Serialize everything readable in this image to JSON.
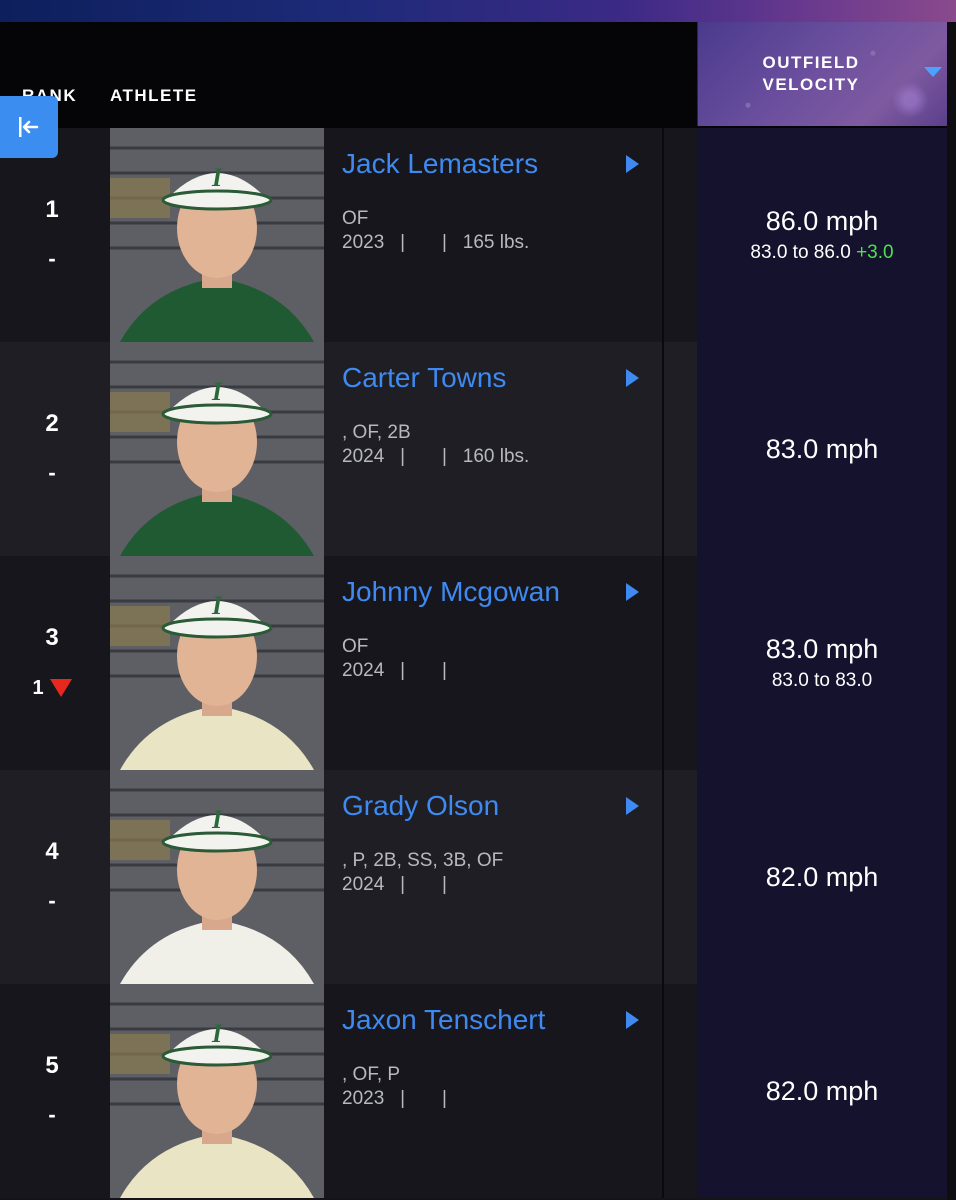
{
  "header": {
    "rank_label": "RANK",
    "athlete_label": "ATHLETE",
    "metric_label_line1": "OUTFIELD",
    "metric_label_line2": "VELOCITY",
    "sort_icon": "sort-desc-triangle",
    "back_icon": "collapse-left-icon"
  },
  "colors": {
    "name_link": "#3e8af0",
    "accent_button": "#3b8ef0",
    "rank_down": "#e8281e",
    "delta_up": "#4ee04e"
  },
  "athletes": [
    {
      "rank": "1",
      "change": "-",
      "name": "Jack Lemasters",
      "positions": "OF",
      "info": "2023   |       |   165 lbs.",
      "velocity": "86.0 mph",
      "range": "83.0 to 86.0",
      "delta": "+3.0",
      "jersey": "#1f5a32"
    },
    {
      "rank": "2",
      "change": "-",
      "name": "Carter Towns",
      "positions": ", OF, 2B",
      "info": "2024   |       |   160 lbs.",
      "velocity": "83.0 mph",
      "range": "",
      "delta": "",
      "jersey": "#1f5a32"
    },
    {
      "rank": "3",
      "change": "1",
      "change_direction": "down",
      "name": "Johnny Mcgowan",
      "positions": "OF",
      "info": "2024   |       |",
      "velocity": "83.0 mph",
      "range": "83.0 to 83.0",
      "delta": "",
      "jersey": "#e9e4c4"
    },
    {
      "rank": "4",
      "change": "-",
      "name": "Grady Olson",
      "positions": ", P, 2B, SS, 3B, OF",
      "info": "2024   |       |",
      "velocity": "82.0 mph",
      "range": "",
      "delta": "",
      "jersey": "#f0efe8"
    },
    {
      "rank": "5",
      "change": "-",
      "name": "Jaxon Tenschert",
      "positions": ", OF, P",
      "info": "2023   |       |",
      "velocity": "82.0 mph",
      "range": "",
      "delta": "",
      "jersey": "#e9e4c4"
    }
  ]
}
